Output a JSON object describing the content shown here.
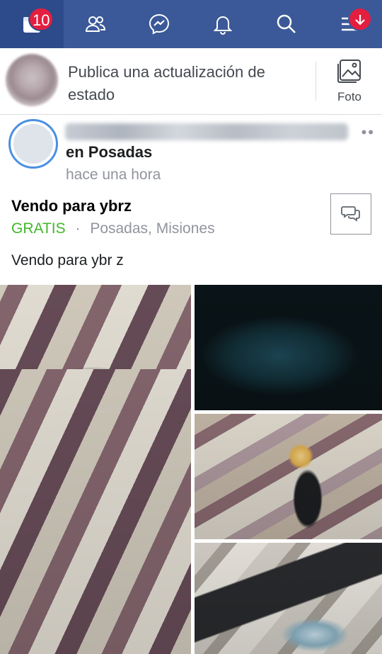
{
  "nav": {
    "items": [
      {
        "name": "news-feed",
        "icon": "news-feed-icon",
        "active": true
      },
      {
        "name": "friends",
        "icon": "friends-icon"
      },
      {
        "name": "messenger",
        "icon": "messenger-icon"
      },
      {
        "name": "notifications",
        "icon": "bell-icon"
      },
      {
        "name": "search",
        "icon": "search-icon"
      },
      {
        "name": "menu",
        "icon": "menu-icon"
      }
    ],
    "feed_badge": "10",
    "colors": {
      "bar": "#3b5998",
      "active": "#2d4a8a",
      "badge": "#e41e3f"
    }
  },
  "composer": {
    "prompt": "Publica una actualización de estado",
    "photo_label": "Foto"
  },
  "post": {
    "location": "en Posadas",
    "time": "hace una hora",
    "listing_title": "Vendo para ybrz",
    "price": "GRATIS",
    "separator": "·",
    "place": "Posadas, Misiones",
    "text": "Vendo para ybr z",
    "more": "••"
  },
  "colors": {
    "price_green": "#42b72a",
    "meta_gray": "#90949c"
  }
}
